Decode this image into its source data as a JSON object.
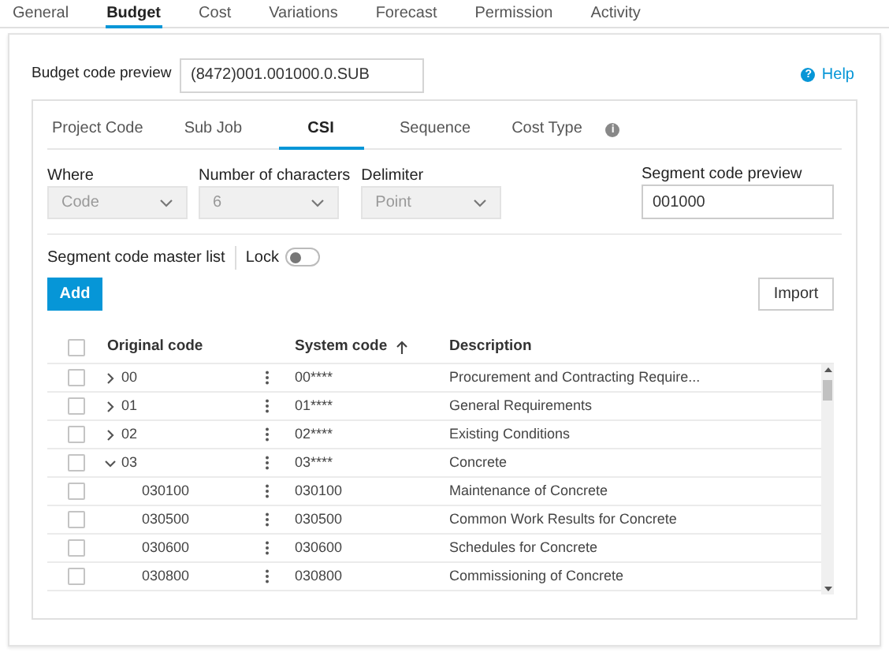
{
  "top_tabs": [
    {
      "label": "General",
      "selected": false
    },
    {
      "label": "Budget",
      "selected": true
    },
    {
      "label": "Cost",
      "selected": false
    },
    {
      "label": "Variations",
      "selected": false
    },
    {
      "label": "Forecast",
      "selected": false
    },
    {
      "label": "Permission",
      "selected": false
    },
    {
      "label": "Activity",
      "selected": false
    }
  ],
  "budget_code_preview": {
    "label": "Budget code preview",
    "value": "(8472)001.001000.0.SUB"
  },
  "help": {
    "icon": "?",
    "label": "Help"
  },
  "info_icon": "i",
  "segment_tabs": [
    {
      "label": "Project Code",
      "selected": false
    },
    {
      "label": "Sub Job",
      "selected": false
    },
    {
      "label": "CSI",
      "selected": true
    },
    {
      "label": "Sequence",
      "selected": false
    },
    {
      "label": "Cost Type",
      "selected": false
    }
  ],
  "fields": [
    {
      "label": "Where",
      "value": "Code",
      "disabled": true
    },
    {
      "label": "Number of characters",
      "value": "6",
      "disabled": true
    },
    {
      "label": "Delimiter",
      "value": "Point",
      "disabled": true
    }
  ],
  "segment_code_preview": {
    "label": "Segment code preview",
    "value": "001000"
  },
  "master_list": {
    "label": "Segment code master list",
    "lock_label": "Lock",
    "lock_on": false
  },
  "buttons": {
    "add": "Add",
    "import": "Import"
  },
  "table": {
    "columns": [
      "Original code",
      "System code",
      "Description"
    ],
    "sort_ascending": true,
    "select_all_checked": false,
    "rows": [
      {
        "original": "00",
        "system": "00****",
        "description": "Procurement and Contracting Require...",
        "checked": false,
        "expanded": false
      },
      {
        "original": "01",
        "system": "01****",
        "description": "General Requirements",
        "checked": false,
        "expanded": false
      },
      {
        "original": "02",
        "system": "02****",
        "description": "Existing Conditions",
        "checked": false,
        "expanded": false
      },
      {
        "original": "03",
        "system": "03****",
        "description": "Concrete",
        "checked": false,
        "expanded": true,
        "children": [
          {
            "original": "030100",
            "system": "030100",
            "description": "Maintenance of Concrete",
            "checked": false
          },
          {
            "original": "030500",
            "system": "030500",
            "description": "Common Work Results for Concrete",
            "checked": false
          },
          {
            "original": "030600",
            "system": "030600",
            "description": "Schedules for Concrete",
            "checked": false
          },
          {
            "original": "030800",
            "system": "030800",
            "description": "Commissioning of Concrete",
            "checked": false
          }
        ]
      }
    ]
  }
}
